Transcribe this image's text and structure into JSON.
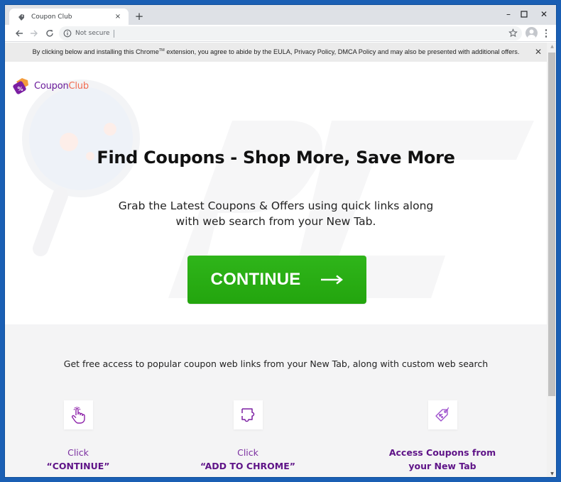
{
  "browser": {
    "tab": {
      "title": "Coupon Club",
      "close_glyph": "×"
    },
    "new_tab_glyph": "+",
    "window_controls": {
      "minimize": "–",
      "maximize": "□",
      "close": "✕"
    },
    "omnibox": {
      "security_label": "Not secure",
      "url": ""
    },
    "icons": [
      "back-arrow-icon",
      "forward-arrow-icon",
      "reload-icon",
      "info-icon",
      "star-icon",
      "profile-icon",
      "menu-dots-icon"
    ]
  },
  "notice": {
    "text_before": "By clicking below and installing this Chrome",
    "trademark": "TM",
    "text_after": " extension, you agree to abide by the EULA, Privacy Policy, DMCA Policy and may also be presented with additional offers.",
    "close_glyph": "✕"
  },
  "logo": {
    "part1": "Coupon",
    "part2": "Club",
    "colors": {
      "primary": "#6a1b9a",
      "secondary": "#f26b50"
    }
  },
  "hero": {
    "headline": "Find Coupons - Shop More, Save More",
    "subtext_line1": "Grab the Latest Coupons & Offers using quick links along",
    "subtext_line2": "with web search from your New Tab.",
    "cta_label": "CONTINUE",
    "cta_color": "#2aae16"
  },
  "features": {
    "intro": "Get free access to popular coupon web links from your New Tab, along with custom web search",
    "steps": [
      {
        "icon": "hand-pointer-icon",
        "line1": "Click",
        "line2": "“CONTINUE”"
      },
      {
        "icon": "puzzle-piece-icon",
        "line1": "Click",
        "line2": "“ADD TO CHROME”"
      },
      {
        "icon": "price-tag-icon",
        "line1": "Access Coupons from",
        "line2": "your New Tab"
      }
    ]
  },
  "scrollbar": {
    "up_glyph": "▲",
    "down_glyph": "▼"
  }
}
